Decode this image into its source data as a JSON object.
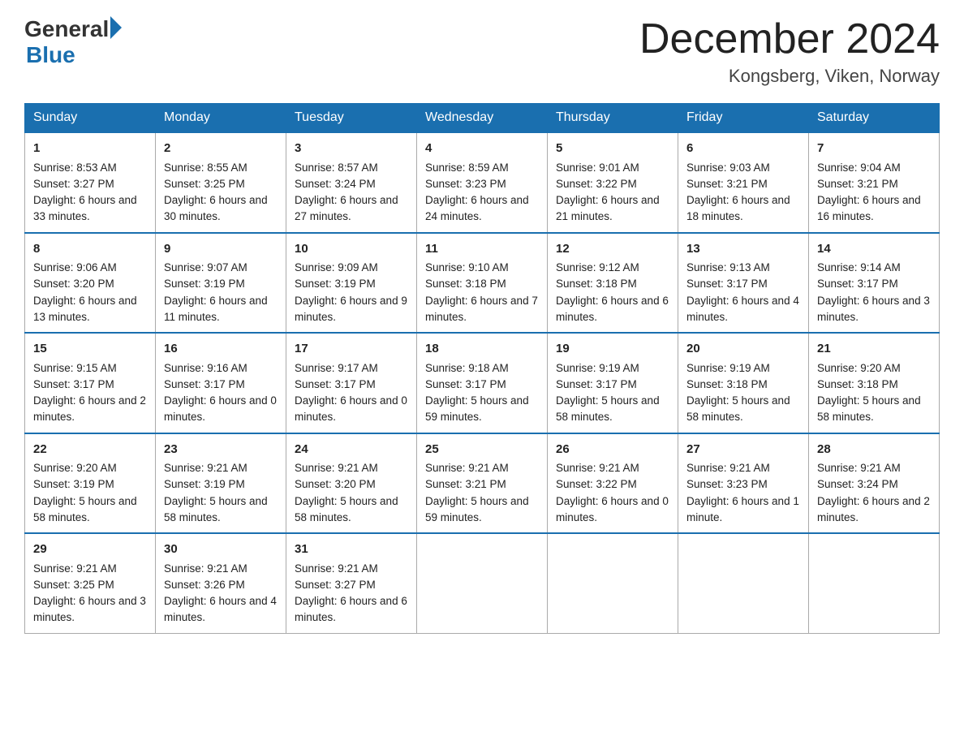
{
  "header": {
    "logo_general": "General",
    "logo_blue": "Blue",
    "title": "December 2024",
    "subtitle": "Kongsberg, Viken, Norway"
  },
  "days_of_week": [
    "Sunday",
    "Monday",
    "Tuesday",
    "Wednesday",
    "Thursday",
    "Friday",
    "Saturday"
  ],
  "weeks": [
    [
      {
        "day": "1",
        "sunrise": "8:53 AM",
        "sunset": "3:27 PM",
        "daylight": "6 hours and 33 minutes."
      },
      {
        "day": "2",
        "sunrise": "8:55 AM",
        "sunset": "3:25 PM",
        "daylight": "6 hours and 30 minutes."
      },
      {
        "day": "3",
        "sunrise": "8:57 AM",
        "sunset": "3:24 PM",
        "daylight": "6 hours and 27 minutes."
      },
      {
        "day": "4",
        "sunrise": "8:59 AM",
        "sunset": "3:23 PM",
        "daylight": "6 hours and 24 minutes."
      },
      {
        "day": "5",
        "sunrise": "9:01 AM",
        "sunset": "3:22 PM",
        "daylight": "6 hours and 21 minutes."
      },
      {
        "day": "6",
        "sunrise": "9:03 AM",
        "sunset": "3:21 PM",
        "daylight": "6 hours and 18 minutes."
      },
      {
        "day": "7",
        "sunrise": "9:04 AM",
        "sunset": "3:21 PM",
        "daylight": "6 hours and 16 minutes."
      }
    ],
    [
      {
        "day": "8",
        "sunrise": "9:06 AM",
        "sunset": "3:20 PM",
        "daylight": "6 hours and 13 minutes."
      },
      {
        "day": "9",
        "sunrise": "9:07 AM",
        "sunset": "3:19 PM",
        "daylight": "6 hours and 11 minutes."
      },
      {
        "day": "10",
        "sunrise": "9:09 AM",
        "sunset": "3:19 PM",
        "daylight": "6 hours and 9 minutes."
      },
      {
        "day": "11",
        "sunrise": "9:10 AM",
        "sunset": "3:18 PM",
        "daylight": "6 hours and 7 minutes."
      },
      {
        "day": "12",
        "sunrise": "9:12 AM",
        "sunset": "3:18 PM",
        "daylight": "6 hours and 6 minutes."
      },
      {
        "day": "13",
        "sunrise": "9:13 AM",
        "sunset": "3:17 PM",
        "daylight": "6 hours and 4 minutes."
      },
      {
        "day": "14",
        "sunrise": "9:14 AM",
        "sunset": "3:17 PM",
        "daylight": "6 hours and 3 minutes."
      }
    ],
    [
      {
        "day": "15",
        "sunrise": "9:15 AM",
        "sunset": "3:17 PM",
        "daylight": "6 hours and 2 minutes."
      },
      {
        "day": "16",
        "sunrise": "9:16 AM",
        "sunset": "3:17 PM",
        "daylight": "6 hours and 0 minutes."
      },
      {
        "day": "17",
        "sunrise": "9:17 AM",
        "sunset": "3:17 PM",
        "daylight": "6 hours and 0 minutes."
      },
      {
        "day": "18",
        "sunrise": "9:18 AM",
        "sunset": "3:17 PM",
        "daylight": "5 hours and 59 minutes."
      },
      {
        "day": "19",
        "sunrise": "9:19 AM",
        "sunset": "3:17 PM",
        "daylight": "5 hours and 58 minutes."
      },
      {
        "day": "20",
        "sunrise": "9:19 AM",
        "sunset": "3:18 PM",
        "daylight": "5 hours and 58 minutes."
      },
      {
        "day": "21",
        "sunrise": "9:20 AM",
        "sunset": "3:18 PM",
        "daylight": "5 hours and 58 minutes."
      }
    ],
    [
      {
        "day": "22",
        "sunrise": "9:20 AM",
        "sunset": "3:19 PM",
        "daylight": "5 hours and 58 minutes."
      },
      {
        "day": "23",
        "sunrise": "9:21 AM",
        "sunset": "3:19 PM",
        "daylight": "5 hours and 58 minutes."
      },
      {
        "day": "24",
        "sunrise": "9:21 AM",
        "sunset": "3:20 PM",
        "daylight": "5 hours and 58 minutes."
      },
      {
        "day": "25",
        "sunrise": "9:21 AM",
        "sunset": "3:21 PM",
        "daylight": "5 hours and 59 minutes."
      },
      {
        "day": "26",
        "sunrise": "9:21 AM",
        "sunset": "3:22 PM",
        "daylight": "6 hours and 0 minutes."
      },
      {
        "day": "27",
        "sunrise": "9:21 AM",
        "sunset": "3:23 PM",
        "daylight": "6 hours and 1 minute."
      },
      {
        "day": "28",
        "sunrise": "9:21 AM",
        "sunset": "3:24 PM",
        "daylight": "6 hours and 2 minutes."
      }
    ],
    [
      {
        "day": "29",
        "sunrise": "9:21 AM",
        "sunset": "3:25 PM",
        "daylight": "6 hours and 3 minutes."
      },
      {
        "day": "30",
        "sunrise": "9:21 AM",
        "sunset": "3:26 PM",
        "daylight": "6 hours and 4 minutes."
      },
      {
        "day": "31",
        "sunrise": "9:21 AM",
        "sunset": "3:27 PM",
        "daylight": "6 hours and 6 minutes."
      },
      null,
      null,
      null,
      null
    ]
  ]
}
